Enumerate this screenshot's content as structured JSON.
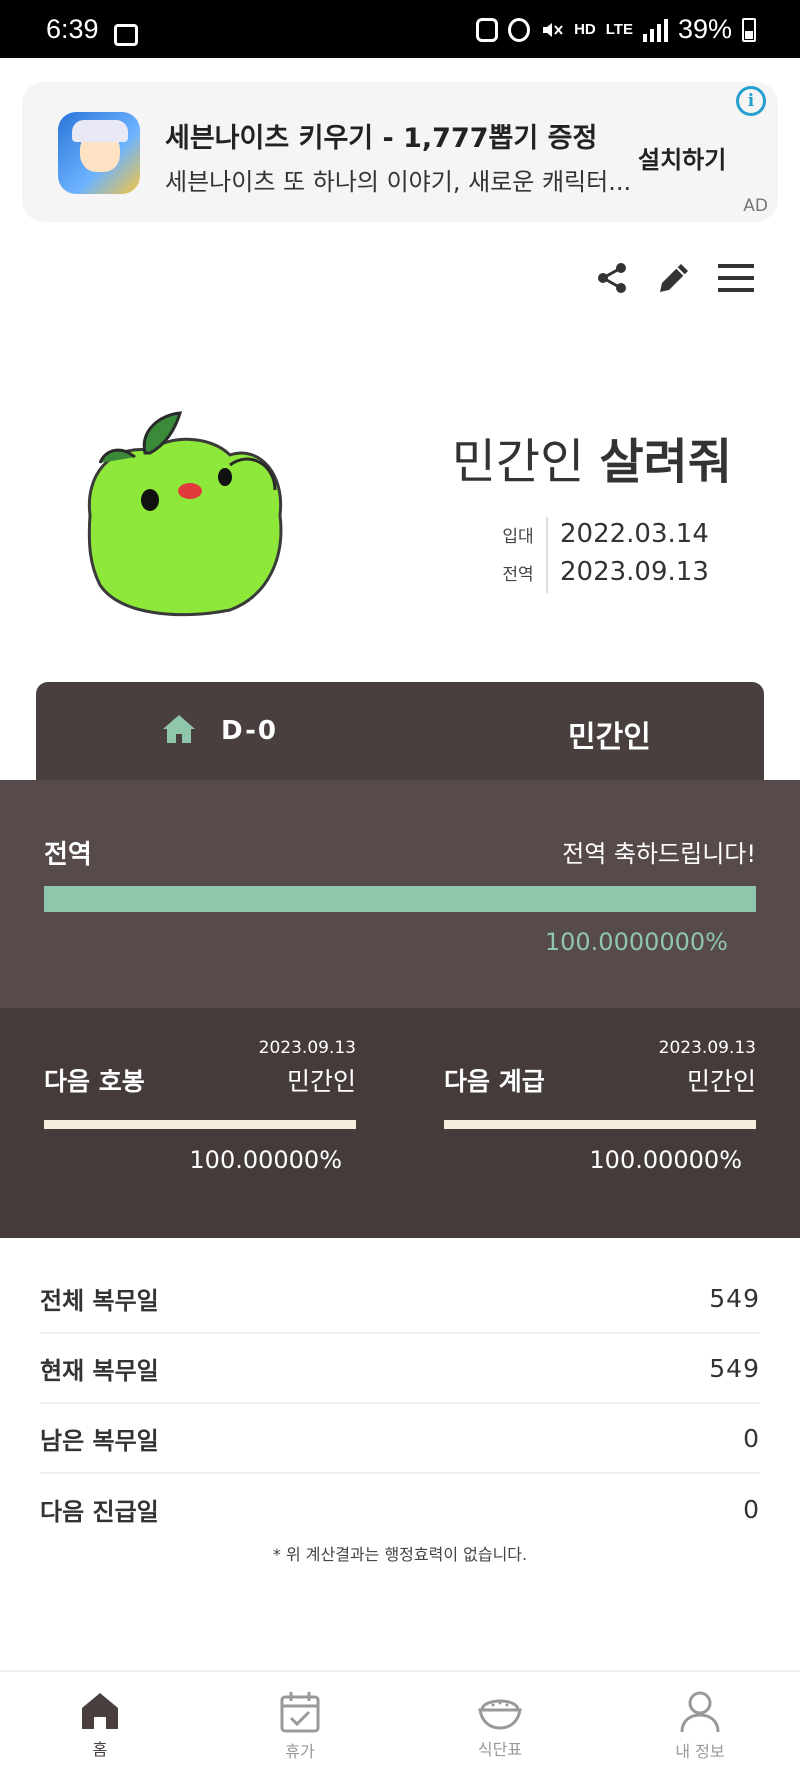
{
  "status_bar": {
    "time": "6:39",
    "network": "HD",
    "lte": "LTE",
    "battery": "39%"
  },
  "ad": {
    "title": "세븐나이츠 키우기 - 1,777뽑기 증정",
    "description": "세븐나이츠 또 하나의 이야기, 새로운 캐릭터...",
    "cta": "설치하기",
    "label": "AD",
    "info": "i"
  },
  "toolbar": {
    "icons": [
      "share-icon",
      "edit-icon",
      "menu-icon"
    ]
  },
  "profile": {
    "name_prefix": "민간인",
    "name_bold": "살려줘",
    "enlist_label": "입대",
    "enlist_date": "2022.03.14",
    "discharge_label": "전역",
    "discharge_date": "2023.09.13"
  },
  "dday": {
    "count": "D-0",
    "status": "민간인"
  },
  "discharge_progress": {
    "label": "전역",
    "message": "전역 축하드립니다!",
    "percent_text": "100.0000000%",
    "fraction": 1.0
  },
  "next_pay": {
    "label": "다음 호봉",
    "date": "2023.09.13",
    "value": "민간인",
    "percent_text": "100.00000%",
    "fraction": 1.0
  },
  "next_rank": {
    "label": "다음 계급",
    "date": "2023.09.13",
    "value": "민간인",
    "percent_text": "100.00000%",
    "fraction": 1.0
  },
  "stats": [
    {
      "label": "전체 복무일",
      "value": "549"
    },
    {
      "label": "현재 복무일",
      "value": "549"
    },
    {
      "label": "남은 복무일",
      "value": "0"
    },
    {
      "label": "다음 진급일",
      "value": "0"
    }
  ],
  "disclaimer": "* 위 계산결과는 행정효력이 없습니다.",
  "bottom_nav": [
    {
      "label": "홈",
      "icon": "home-icon",
      "active": true
    },
    {
      "label": "휴가",
      "icon": "calendar-check-icon",
      "active": false
    },
    {
      "label": "식단표",
      "icon": "rice-bowl-icon",
      "active": false
    },
    {
      "label": "내 정보",
      "icon": "person-icon",
      "active": false
    }
  ],
  "colors": {
    "dark_brown": "#4a3f3f",
    "progress_green": "#8fc6ac",
    "cream": "#f3efdc"
  }
}
